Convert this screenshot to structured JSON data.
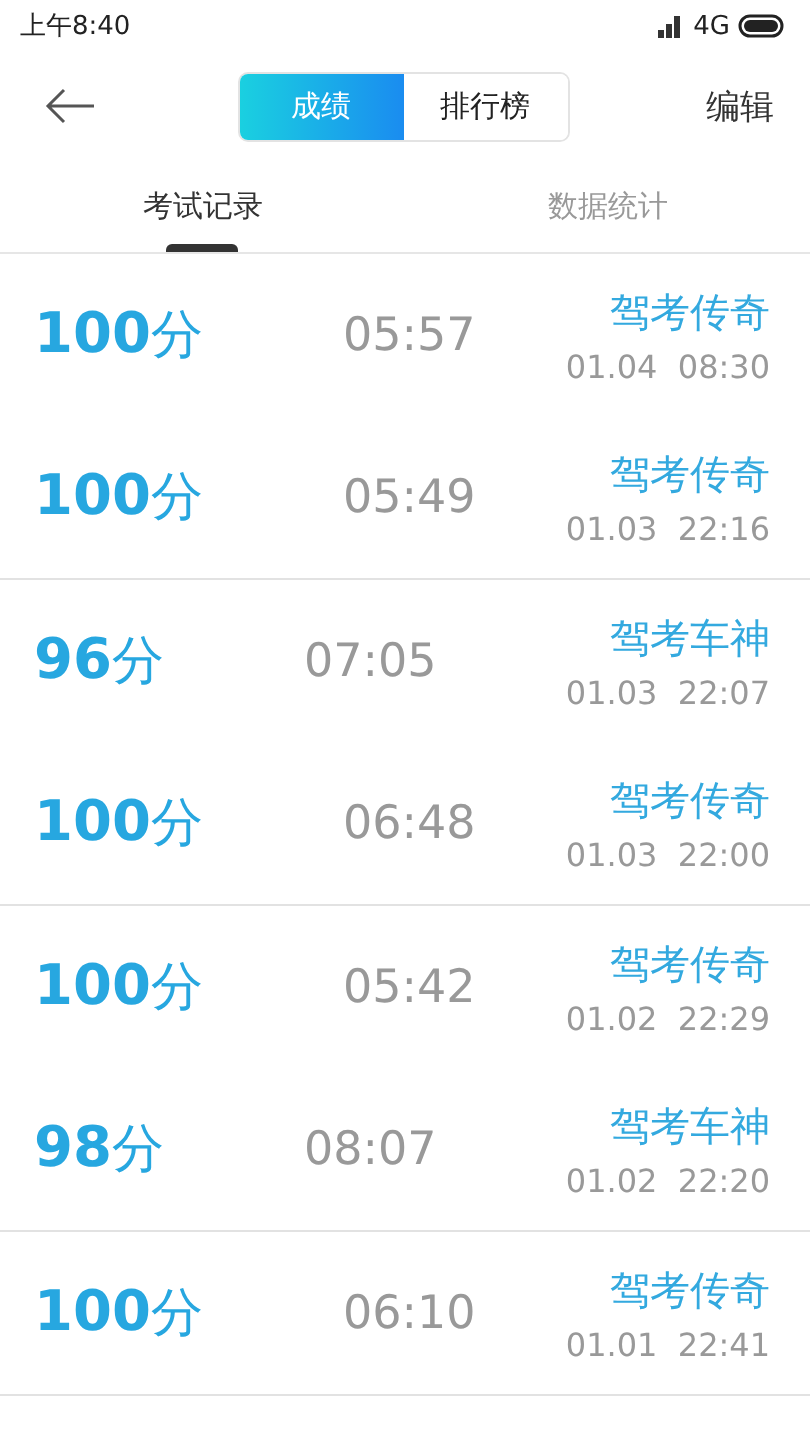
{
  "status_bar": {
    "time": "上午8:40",
    "network": "4G"
  },
  "header": {
    "segments": [
      {
        "label": "成绩",
        "selected": true
      },
      {
        "label": "排行榜",
        "selected": false
      }
    ],
    "action": "编辑"
  },
  "tabs": [
    {
      "label": "考试记录",
      "selected": true
    },
    {
      "label": "数据统计",
      "selected": false
    }
  ],
  "groups": [
    {
      "records": [
        {
          "score": "**100**分",
          "duration": "05:57",
          "title": "驾考传奇",
          "date": "01.04",
          "time": "08:30"
        },
        {
          "score": "**100**分",
          "duration": "05:49",
          "title": "驾考传奇",
          "date": "01.03",
          "time": "22:16"
        }
      ]
    },
    {
      "records": [
        {
          "score": "**96**分",
          "duration": "07:05",
          "title": "驾考车神",
          "date": "01.03",
          "time": "22:07"
        },
        {
          "score": "**100**分",
          "duration": "06:48",
          "title": "驾考传奇",
          "date": "01.03",
          "time": "22:00"
        }
      ]
    },
    {
      "records": [
        {
          "score": "**100**分",
          "duration": "05:42",
          "title": "驾考传奇",
          "date": "01.02",
          "time": "22:29"
        },
        {
          "score": "**98**分",
          "duration": "08:07",
          "title": "驾考车神",
          "date": "01.02",
          "time": "22:20"
        }
      ]
    },
    {
      "records": [
        {
          "score": "**100**分",
          "duration": "06:10",
          "title": "驾考传奇",
          "date": "01.01",
          "time": "22:41"
        }
      ]
    }
  ]
}
